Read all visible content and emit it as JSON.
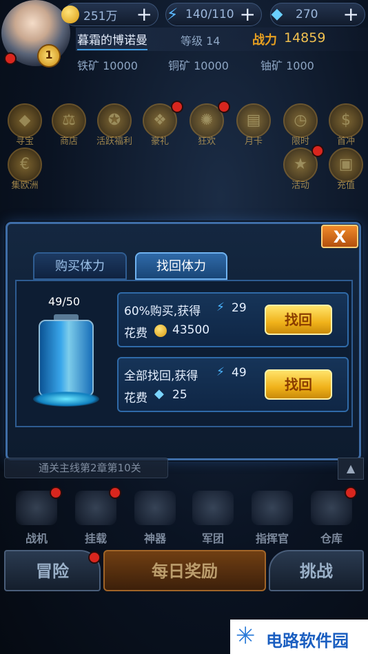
{
  "resources": {
    "gold": "251万",
    "energy": "140/110",
    "diamond": "270",
    "plus": "+"
  },
  "player": {
    "name": "暮霜的博诺曼",
    "level_label": "等级 14",
    "power_label": "战力",
    "power_value": "14859",
    "vip": "1",
    "iron": "铁矿 10000",
    "copper": "铜矿 10000",
    "uranium": "铀矿 1000"
  },
  "functions": [
    {
      "label": "寻宝",
      "icon": "treasure-icon"
    },
    {
      "label": "商店",
      "icon": "scale-icon"
    },
    {
      "label": "活跃福利",
      "icon": "reward-icon"
    },
    {
      "label": "豪礼",
      "icon": "gift-icon"
    },
    {
      "label": "狂欢",
      "icon": "firework-icon"
    },
    {
      "label": "月卡",
      "icon": "card-icon"
    },
    {
      "label": "限时",
      "icon": "clock-icon"
    },
    {
      "label": "首冲",
      "icon": "money-icon"
    },
    {
      "label": "集欧洲",
      "icon": "euro-icon"
    },
    {
      "label": "活动",
      "icon": "star-icon"
    },
    {
      "label": "充值",
      "icon": "recharge-icon"
    }
  ],
  "modal": {
    "close": "X",
    "tab_buy": "购买体力",
    "tab_recover": "找回体力",
    "stamina": "49/50",
    "option1": {
      "title": "60%购买,获得",
      "gain": "29",
      "cost_label": "花费",
      "cost": "43500",
      "button": "找回"
    },
    "option2": {
      "title": "全部找回,获得",
      "gain": "49",
      "cost_label": "花费",
      "cost": "25",
      "button": "找回"
    }
  },
  "mission_text": "通关主线第2章第10关",
  "bottom_nav": [
    {
      "label": "战机",
      "icon": "fighter-icon"
    },
    {
      "label": "挂载",
      "icon": "cannon-icon"
    },
    {
      "label": "神器",
      "icon": "gem-icon"
    },
    {
      "label": "军团",
      "icon": "legion-icon"
    },
    {
      "label": "指挥官",
      "icon": "commander-icon"
    },
    {
      "label": "仓库",
      "icon": "warehouse-icon"
    }
  ],
  "actions": {
    "adventure": "冒险",
    "daily": "每日奖励",
    "challenge": "挑战"
  },
  "watermark": "电路软件园",
  "colors": {
    "accent_gold": "#f0b21a",
    "panel_blue": "#2f6aa8",
    "power_orange": "#e8a020"
  }
}
